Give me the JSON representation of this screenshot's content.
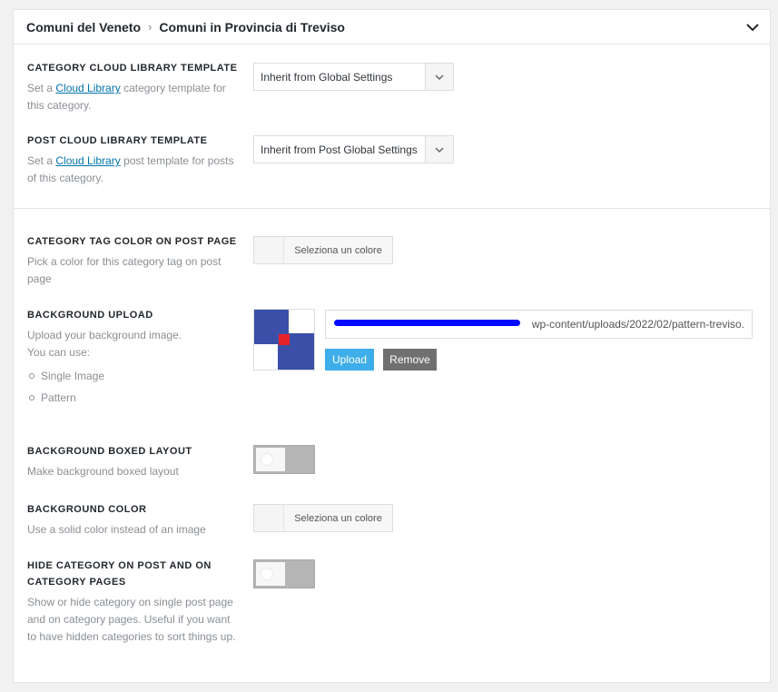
{
  "header": {
    "crumb1": "Comuni del Veneto",
    "separator": "›",
    "crumb2": "Comuni in Provincia di Treviso"
  },
  "cloud_category": {
    "label": "CATEGORY CLOUD LIBRARY TEMPLATE",
    "desc_before": "Set a ",
    "link": "Cloud Library",
    "desc_after": " category template for this category.",
    "select_value": "Inherit from Global Settings"
  },
  "cloud_post": {
    "label": "POST CLOUD LIBRARY TEMPLATE",
    "desc_before": "Set a ",
    "link": "Cloud Library",
    "desc_after": " post template for posts of this category.",
    "select_value": "Inherit from Post Global Settings"
  },
  "tag_color": {
    "label": "CATEGORY TAG COLOR ON POST PAGE",
    "desc": "Pick a color for this category tag on post page",
    "button": "Seleziona un colore"
  },
  "bg_upload": {
    "label": "BACKGROUND UPLOAD",
    "desc1": "Upload your background image.",
    "desc2": "You can use:",
    "options": [
      "Single Image",
      "Pattern"
    ],
    "url": "wp-content/uploads/2022/02/pattern-treviso.",
    "upload_btn": "Upload",
    "remove_btn": "Remove",
    "colors": {
      "blue": "#3b4fa8",
      "red": "#e8222a"
    }
  },
  "boxed": {
    "label": "BACKGROUND BOXED LAYOUT",
    "desc": "Make background boxed layout",
    "enabled": false
  },
  "bg_color": {
    "label": "BACKGROUND COLOR",
    "desc": "Use a solid color instead of an image",
    "button": "Seleziona un colore"
  },
  "hide_cat": {
    "label": "HIDE CATEGORY ON POST AND ON CATEGORY PAGES",
    "desc": "Show or hide category on single post page and on category pages. Useful if you want to have hidden categories to sort things up.",
    "enabled": false
  }
}
